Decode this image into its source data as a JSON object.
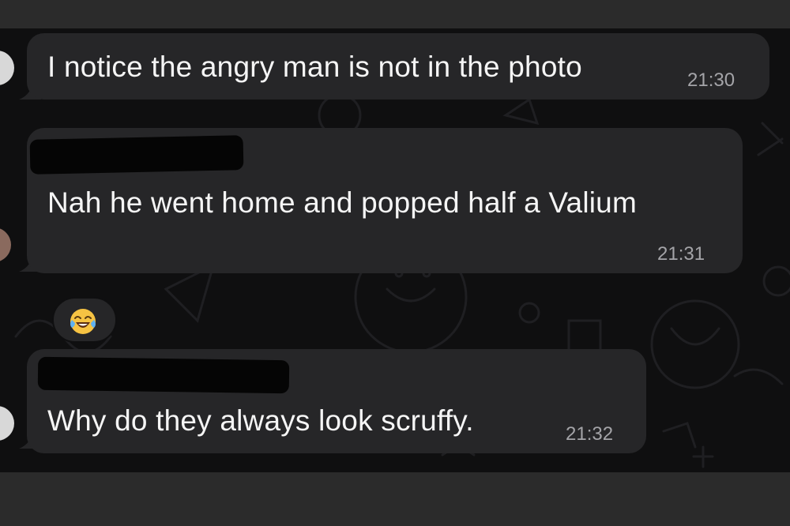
{
  "messages": [
    {
      "text": "I notice the angry man is not in the photo",
      "time": "21:30"
    },
    {
      "text": "Nah he went home and popped half a Valium",
      "time": "21:31",
      "reaction": "face-with-tears-of-joy"
    },
    {
      "text": "Why do they always look scruffy.",
      "time": "21:32"
    }
  ],
  "colors": {
    "bubble": "#262628",
    "background": "#0f0f10",
    "frame": "#2b2b2b",
    "timestamp": "#a4a4a8"
  }
}
